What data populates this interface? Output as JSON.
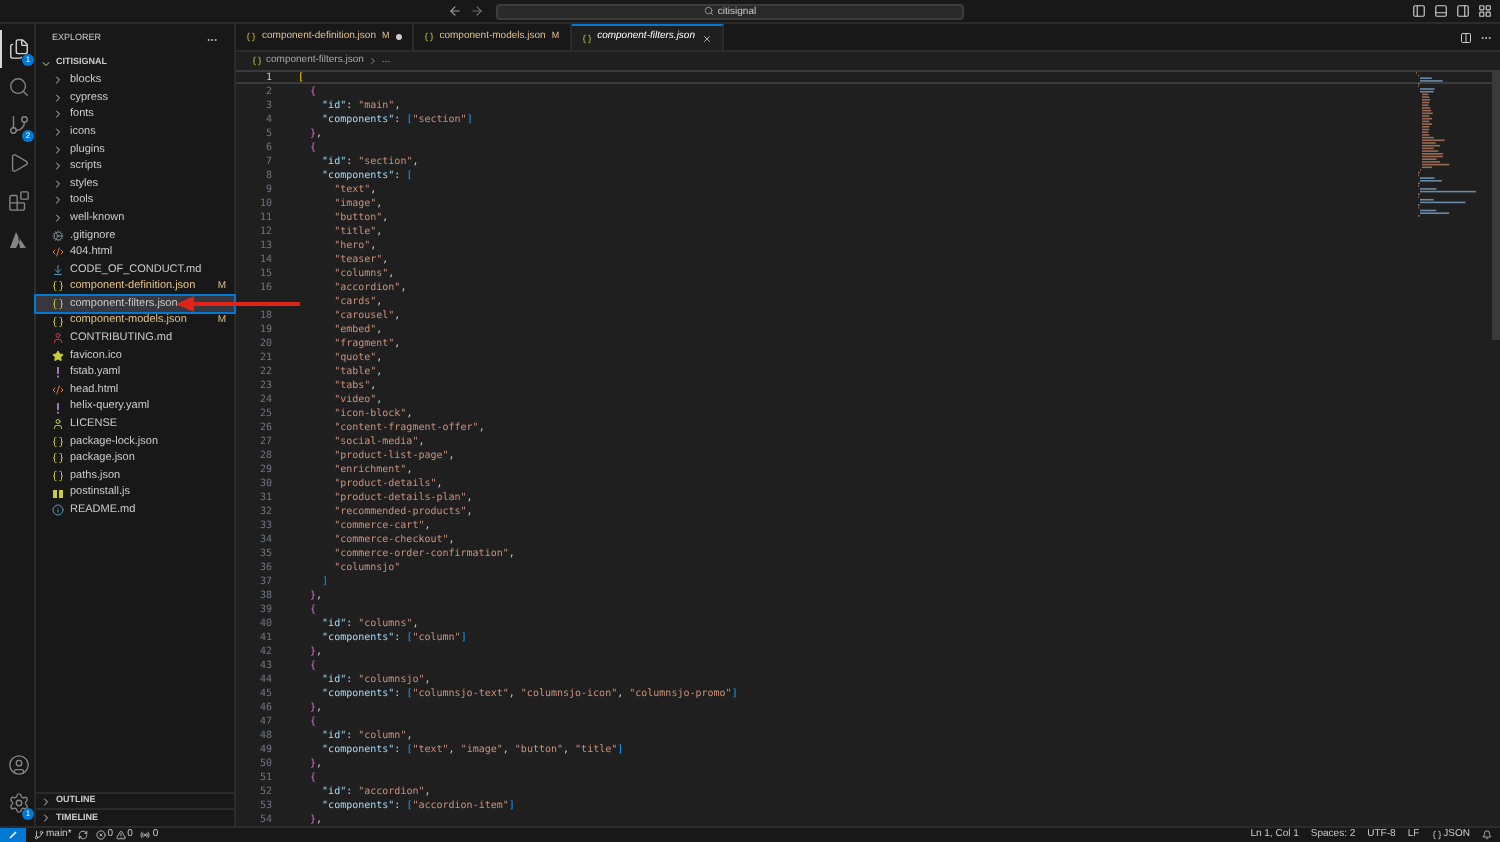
{
  "activity_bar": {
    "items": [
      {
        "kind": "files",
        "selected": true,
        "badge": "1"
      },
      {
        "kind": "search",
        "selected": false
      },
      {
        "kind": "source-control",
        "selected": false,
        "badge": "2"
      },
      {
        "kind": "run",
        "selected": false
      },
      {
        "kind": "extensions",
        "selected": false
      },
      {
        "kind": "azure",
        "selected": false
      }
    ],
    "bottom": [
      {
        "kind": "account"
      },
      {
        "kind": "settings",
        "badge": "1"
      }
    ]
  },
  "title_bar": {
    "search": "citisignal"
  },
  "sidebar": {
    "title": "EXPLORER",
    "root": "CITISIGNAL",
    "expanded": true,
    "items": [
      {
        "name": "blocks",
        "kind": "folder",
        "expanded": false
      },
      {
        "name": "cypress",
        "kind": "folder",
        "expanded": false
      },
      {
        "name": "fonts",
        "kind": "folder",
        "expanded": false
      },
      {
        "name": "icons",
        "kind": "folder",
        "expanded": false
      },
      {
        "name": "plugins",
        "kind": "folder",
        "expanded": false
      },
      {
        "name": "scripts",
        "kind": "folder",
        "expanded": false
      },
      {
        "name": "styles",
        "kind": "folder",
        "expanded": false
      },
      {
        "name": "tools",
        "kind": "folder",
        "expanded": false
      },
      {
        "name": "well-known",
        "kind": "folder",
        "expanded": false
      },
      {
        "name": ".gitignore",
        "kind": "git"
      },
      {
        "name": "404.html",
        "kind": "html"
      },
      {
        "name": "CODE_OF_CONDUCT.md",
        "kind": "md"
      },
      {
        "name": "component-definition.json",
        "kind": "json",
        "status": "M",
        "selected": false
      },
      {
        "name": "component-filters.json",
        "kind": "json",
        "selected": true
      },
      {
        "name": "component-models.json",
        "kind": "json",
        "status": "M",
        "selected": false
      },
      {
        "name": "CONTRIBUTING.md",
        "kind": "contrib"
      },
      {
        "name": "favicon.ico",
        "kind": "star"
      },
      {
        "name": "fstab.yaml",
        "kind": "yaml"
      },
      {
        "name": "head.html",
        "kind": "html"
      },
      {
        "name": "helix-query.yaml",
        "kind": "yaml"
      },
      {
        "name": "LICENSE",
        "kind": "license"
      },
      {
        "name": "package-lock.json",
        "kind": "json"
      },
      {
        "name": "package.json",
        "kind": "json"
      },
      {
        "name": "paths.json",
        "kind": "json"
      },
      {
        "name": "postinstall.js",
        "kind": "js"
      },
      {
        "name": "README.md",
        "kind": "info"
      }
    ],
    "sections": [
      {
        "label": "OUTLINE",
        "expanded": false
      },
      {
        "label": "TIMELINE",
        "expanded": false
      }
    ]
  },
  "tabs": [
    {
      "label": "component-definition.json",
      "status": "M",
      "dirty": true,
      "selected": false
    },
    {
      "label": "component-models.json",
      "status": "M",
      "dirty": false,
      "selected": false
    },
    {
      "label": "component-filters.json",
      "dirty": false,
      "selected": true
    }
  ],
  "breadcrumb": [
    "component-filters.json",
    "..."
  ],
  "editor": {
    "lines": [
      {
        "number": "1",
        "text": "[",
        "current": true
      },
      {
        "number": "2",
        "text": "  {",
        "current": false
      },
      {
        "number": "3",
        "text": "    \"id\": \"main\",",
        "current": false
      },
      {
        "number": "4",
        "text": "    \"components\": [\"section\"]",
        "current": false
      },
      {
        "number": "5",
        "text": "  },",
        "current": false
      },
      {
        "number": "6",
        "text": "  {",
        "current": false
      },
      {
        "number": "7",
        "text": "    \"id\": \"section\",",
        "current": false
      },
      {
        "number": "8",
        "text": "    \"components\": [",
        "current": false
      },
      {
        "number": "9",
        "text": "      \"text\",",
        "current": false
      },
      {
        "number": "10",
        "text": "      \"image\",",
        "current": false
      },
      {
        "number": "11",
        "text": "      \"button\",",
        "current": false
      },
      {
        "number": "12",
        "text": "      \"title\",",
        "current": false
      },
      {
        "number": "13",
        "text": "      \"hero\",",
        "current": false
      },
      {
        "number": "14",
        "text": "      \"teaser\",",
        "current": false
      },
      {
        "number": "15",
        "text": "      \"columns\",",
        "current": false
      },
      {
        "number": "16",
        "text": "      \"accordion\",",
        "current": false
      },
      {
        "text": "      \"cards\",",
        "current": false
      },
      {
        "number": "18",
        "text": "      \"carousel\",",
        "current": false
      },
      {
        "number": "19",
        "text": "      \"embed\",",
        "current": false
      },
      {
        "number": "20",
        "text": "      \"fragment\",",
        "current": false
      },
      {
        "number": "21",
        "text": "      \"quote\",",
        "current": false
      },
      {
        "number": "22",
        "text": "      \"table\",",
        "current": false
      },
      {
        "number": "23",
        "text": "      \"tabs\",",
        "current": false
      },
      {
        "number": "24",
        "text": "      \"video\",",
        "current": false
      },
      {
        "number": "25",
        "text": "      \"icon-block\",",
        "current": false
      },
      {
        "number": "26",
        "text": "      \"content-fragment-offer\",",
        "current": false
      },
      {
        "number": "27",
        "text": "      \"social-media\",",
        "current": false
      },
      {
        "number": "28",
        "text": "      \"product-list-page\",",
        "current": false
      },
      {
        "number": "29",
        "text": "      \"enrichment\",",
        "current": false
      },
      {
        "number": "30",
        "text": "      \"product-details\",",
        "current": false
      },
      {
        "number": "31",
        "text": "      \"product-details-plan\",",
        "current": false
      },
      {
        "number": "32",
        "text": "      \"recommended-products\",",
        "current": false
      },
      {
        "number": "33",
        "text": "      \"commerce-cart\",",
        "current": false
      },
      {
        "number": "34",
        "text": "      \"commerce-checkout\",",
        "current": false
      },
      {
        "number": "35",
        "text": "      \"commerce-order-confirmation\",",
        "current": false
      },
      {
        "number": "36",
        "text": "      \"columnsjo\"",
        "current": false
      },
      {
        "number": "37",
        "text": "    ]",
        "current": false
      },
      {
        "number": "38",
        "text": "  },",
        "current": false
      },
      {
        "number": "39",
        "text": "  {",
        "current": false
      },
      {
        "number": "40",
        "text": "    \"id\": \"columns\",",
        "current": false
      },
      {
        "number": "41",
        "text": "    \"components\": [\"column\"]",
        "current": false
      },
      {
        "number": "42",
        "text": "  },",
        "current": false
      },
      {
        "number": "43",
        "text": "  {",
        "current": false
      },
      {
        "number": "44",
        "text": "    \"id\": \"columnsjo\",",
        "current": false
      },
      {
        "number": "45",
        "text": "    \"components\": [\"columnsjo-text\", \"columnsjo-icon\", \"columnsjo-promo\"]",
        "current": false
      },
      {
        "number": "46",
        "text": "  },",
        "current": false
      },
      {
        "number": "47",
        "text": "  {",
        "current": false
      },
      {
        "number": "48",
        "text": "    \"id\": \"column\",",
        "current": false
      },
      {
        "number": "49",
        "text": "    \"components\": [\"text\", \"image\", \"button\", \"title\"]",
        "current": false
      },
      {
        "number": "50",
        "text": "  },",
        "current": false
      },
      {
        "number": "51",
        "text": "  {",
        "current": false
      },
      {
        "number": "52",
        "text": "    \"id\": \"accordion\",",
        "current": false
      },
      {
        "number": "53",
        "text": "    \"components\": [\"accordion-item\"]",
        "current": false
      },
      {
        "number": "54",
        "text": "  },",
        "current": false
      }
    ]
  },
  "status_bar": {
    "branch": "main*",
    "errors": "0",
    "warnings": "0",
    "ports": "0",
    "position": "Ln 1, Col 1",
    "spaces": "Spaces: 2",
    "encoding": "UTF-8",
    "eol": "LF",
    "language": "JSON"
  }
}
